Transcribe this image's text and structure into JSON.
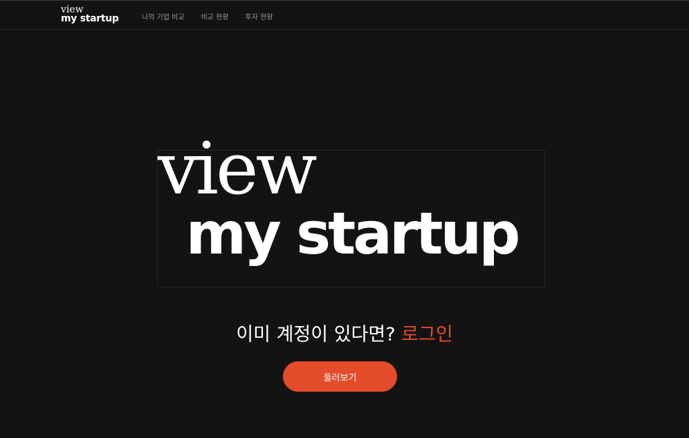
{
  "header": {
    "logo_line1": "view",
    "logo_line2": "my startup",
    "nav": [
      {
        "label": "나의 기업 비교"
      },
      {
        "label": "비교 현황"
      },
      {
        "label": "투자 현황"
      }
    ]
  },
  "hero": {
    "logo_line1": "view",
    "logo_line2": "my startup"
  },
  "login": {
    "prompt": "이미 계정이 있다면? ",
    "link_label": "로그인"
  },
  "cta": {
    "browse_label": "둘러보기"
  },
  "colors": {
    "background": "#131313",
    "accent": "#e44b2b",
    "text": "#ffffff",
    "nav_text": "#9a9a9a"
  }
}
